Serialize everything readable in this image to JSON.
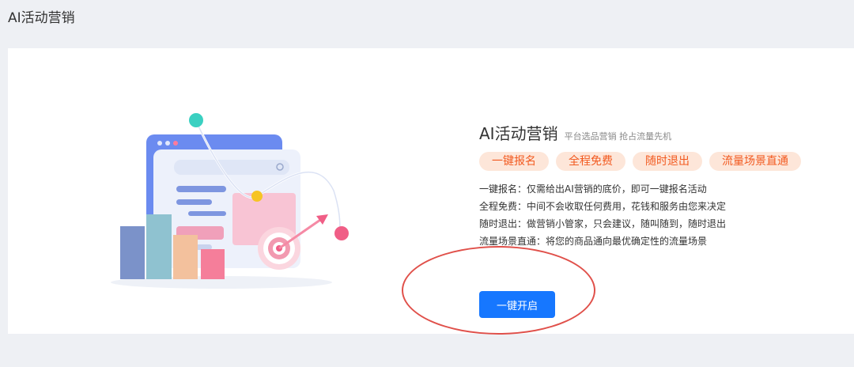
{
  "page": {
    "title": "AI活动营销"
  },
  "intro": {
    "heading": "AI活动营销",
    "subheading": "平台选品营销 抢占流量先机",
    "tags": [
      "一键报名",
      "全程免费",
      "随时退出",
      "流量场景直通"
    ],
    "features": [
      "一键报名：仅需给出AI营销的底价，即可一键报名活动",
      "全程免费：中间不会收取任何费用，花钱和服务由您来决定",
      "随时退出：做营销小管家，只会建议，随叫随到，随时退出",
      "流量场景直通：将您的商品通向最优确定性的流量场景"
    ],
    "start_button": "一键开启"
  },
  "colors": {
    "primary": "#1677ff",
    "tag_bg": "#fde6d9",
    "tag_text": "#f25a20",
    "annotation": "#e0504a"
  }
}
